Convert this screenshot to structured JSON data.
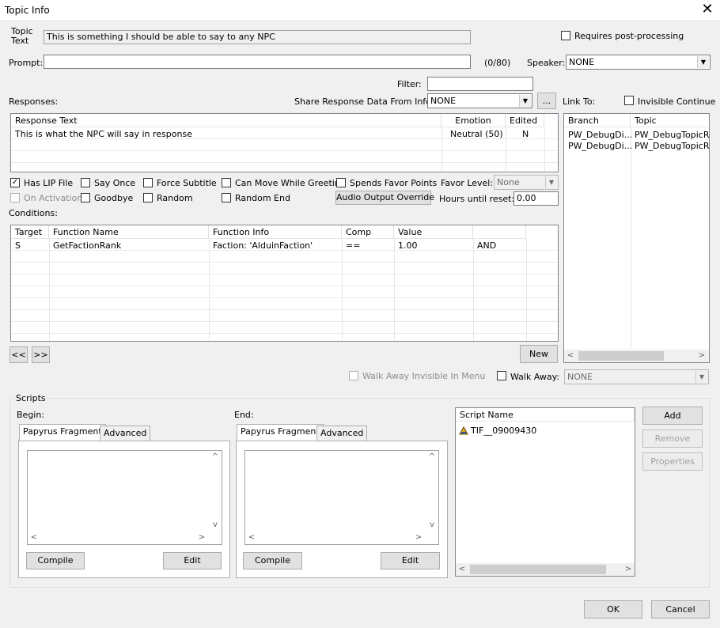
{
  "window": {
    "title": "Topic Info"
  },
  "topic": {
    "label_line1": "Topic",
    "label_line2": "Text",
    "value": "This is something I should be able to say to any NPC"
  },
  "requires_post_processing": {
    "label": "Requires post-processing",
    "checked": false
  },
  "prompt": {
    "label": "Prompt:",
    "value": "",
    "counter": "(0/80)"
  },
  "speaker": {
    "label": "Speaker:",
    "value": "NONE"
  },
  "filter": {
    "label": "Filter:",
    "value": ""
  },
  "responses": {
    "label": "Responses:",
    "share_label": "Share Response Data From Info:",
    "share_value": "NONE",
    "share_button": "...",
    "columns": [
      "Response Text",
      "Emotion",
      "Edited"
    ],
    "rows": [
      {
        "text": "This is what the NPC will say in response",
        "emotion": "Neutral (50)",
        "edited": "N"
      }
    ]
  },
  "link_to": {
    "label": "Link To:",
    "invisible_continue": "Invisible Continue",
    "columns": [
      "Branch",
      "Topic"
    ],
    "rows": [
      {
        "branch": "PW_DebugDi...",
        "topic": "PW_DebugTopicRes"
      },
      {
        "branch": "PW_DebugDi...",
        "topic": "PW_DebugTopicRes"
      }
    ]
  },
  "flags": {
    "has_lip_file": "Has LIP File",
    "say_once": "Say Once",
    "force_subtitle": "Force Subtitle",
    "can_move_while_greeting": "Can Move While Greeting",
    "spends_favor_points": "Spends Favor Points",
    "favor_level_label": "Favor Level:",
    "favor_level_value": "None",
    "on_activation": "On Activation",
    "goodbye": "Goodbye",
    "random": "Random",
    "random_end": "Random End",
    "audio_output_override": "Audio Output Override",
    "hours_label": "Hours until reset:",
    "hours_value": "0.00"
  },
  "conditions": {
    "label": "Conditions:",
    "columns": [
      "Target",
      "Function Name",
      "Function Info",
      "Comp",
      "Value",
      ""
    ],
    "rows": [
      {
        "target": "S",
        "function": "GetFactionRank",
        "info": "Faction: 'AlduinFaction'",
        "comp": "==",
        "value": "1.00",
        "logic": "AND"
      }
    ],
    "prev_button": "<<",
    "next_button": ">>",
    "new_button": "New"
  },
  "walk_away": {
    "invisible_label": "Walk Away Invisible In Menu",
    "label": "Walk Away:",
    "value": "NONE"
  },
  "scripts": {
    "group_label": "Scripts",
    "begin_label": "Begin:",
    "end_label": "End:",
    "tab_papyrus": "Papyrus Fragment",
    "tab_advanced": "Advanced",
    "compile": "Compile",
    "edit": "Edit",
    "list_header": "Script Name",
    "items": [
      "TIF__09009430"
    ],
    "add": "Add",
    "remove": "Remove",
    "properties": "Properties"
  },
  "footer": {
    "ok": "OK",
    "cancel": "Cancel"
  }
}
